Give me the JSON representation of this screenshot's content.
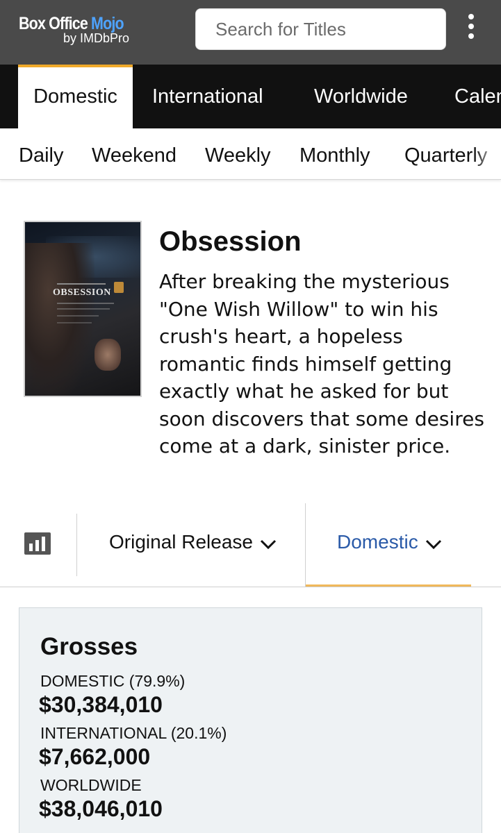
{
  "header": {
    "logo_main": "Box Office ",
    "logo_accent": "Mojo",
    "logo_sub": "by IMDbPro",
    "search_placeholder": "Search for Titles",
    "menu_icon": "kebab-menu-icon"
  },
  "tabs": [
    {
      "label": "Domestic",
      "active": true
    },
    {
      "label": "International",
      "active": false
    },
    {
      "label": "Worldwide",
      "active": false
    },
    {
      "label": "Calendar",
      "active": false
    }
  ],
  "subnav": [
    "Daily",
    "Weekend",
    "Weekly",
    "Monthly",
    "Quarterly"
  ],
  "movie": {
    "title": "Obsession",
    "description": "After breaking the mysterious \"One Wish Willow\" to win his crush's heart, a hopeless romantic finds himself getting exactly what he asked for but soon discovers that some desires come at a dark, sinister price.",
    "poster_title": "OBSESSION"
  },
  "selector": {
    "release_label": "Original Release",
    "region_label": "Domestic"
  },
  "grosses": {
    "title": "Grosses",
    "domestic_label": "DOMESTIC (79.9%)",
    "domestic_value": "$30,384,010",
    "international_label": "INTERNATIONAL (20.1%)",
    "international_value": "$7,662,000",
    "worldwide_label": "WORLDWIDE",
    "worldwide_value": "$38,046,010"
  },
  "colors": {
    "header_bg": "#4a4a4a",
    "tabs_bg": "#111111",
    "accent_orange": "#f0a92a",
    "link_blue": "#2a5aa8",
    "panel_bg": "#eef2f4"
  }
}
